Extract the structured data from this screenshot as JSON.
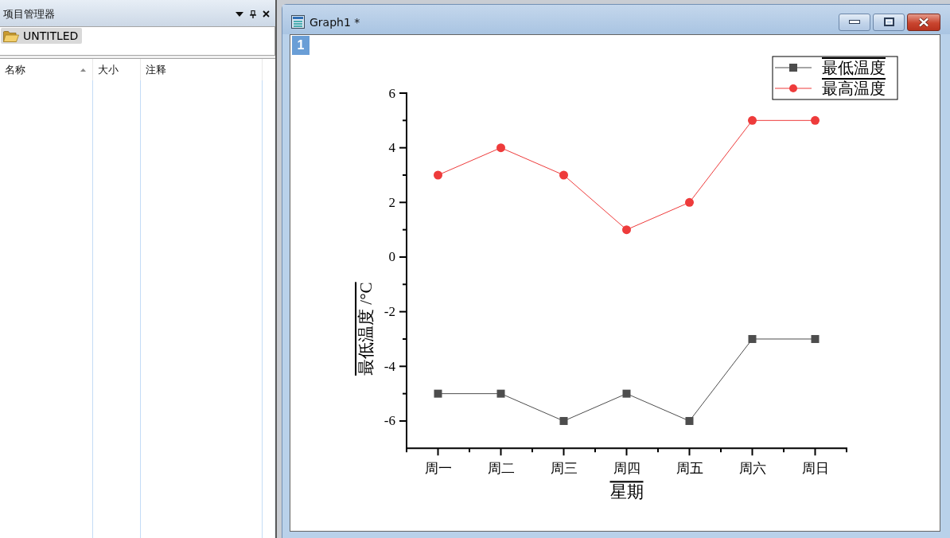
{
  "project_explorer": {
    "title": "项目管理器",
    "folders": [
      {
        "label": "UNTITLED",
        "selected": true
      }
    ],
    "columns": [
      {
        "label": "名称",
        "sorted": true
      },
      {
        "label": "大小",
        "sorted": false
      },
      {
        "label": "注释",
        "sorted": false
      }
    ]
  },
  "graph_window": {
    "title": "Graph1 *",
    "layer": "1",
    "chart_data": {
      "type": "line",
      "xlabel": "星期",
      "ylabel": "最低温度 /°C",
      "categories": [
        "周一",
        "周二",
        "周三",
        "周四",
        "周五",
        "周六",
        "周日"
      ],
      "series": [
        {
          "name": "最低温度",
          "color": "#4d4d4d",
          "marker": "square",
          "values": [
            -5,
            -5,
            -6,
            -5,
            -6,
            -3,
            -3
          ]
        },
        {
          "name": "最高温度",
          "color": "#ee3b3b",
          "marker": "circle",
          "values": [
            3,
            4,
            3,
            1,
            2,
            5,
            5
          ]
        }
      ],
      "ylim": [
        -7,
        6
      ],
      "yticks": [
        -6,
        -4,
        -2,
        0,
        2,
        4,
        6
      ],
      "legend": "upper right"
    }
  }
}
